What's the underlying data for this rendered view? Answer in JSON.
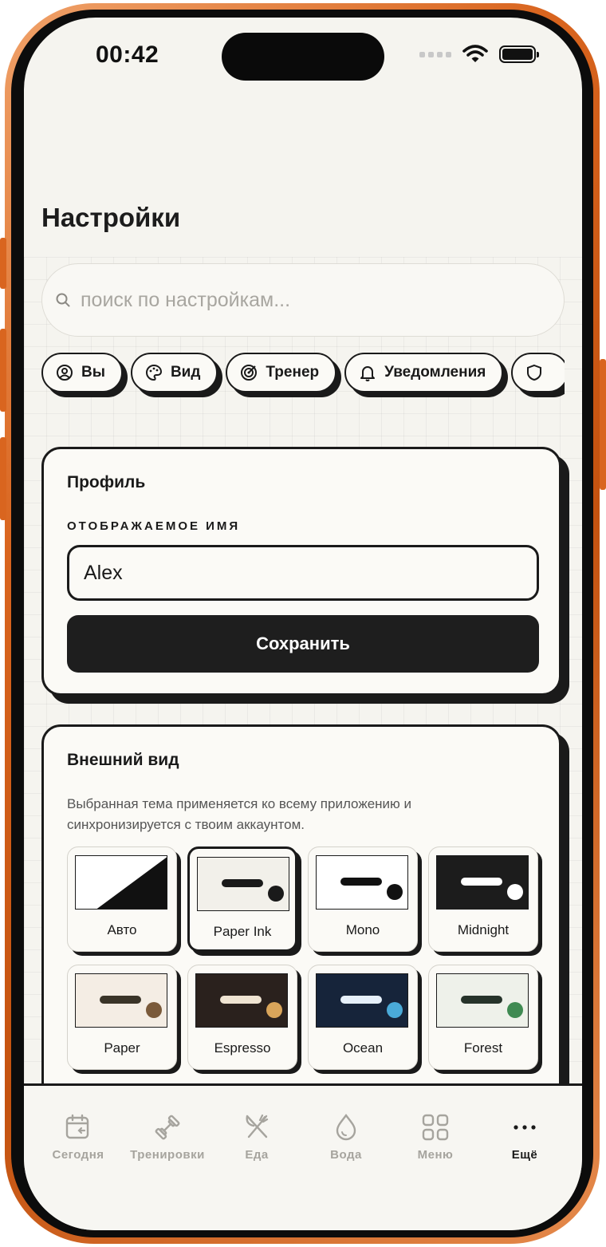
{
  "status_bar": {
    "time": "00:42"
  },
  "header": {
    "title": "Настройки"
  },
  "search": {
    "placeholder": "поиск по настройкам..."
  },
  "chips": [
    {
      "label": "Вы",
      "icon": "user-icon"
    },
    {
      "label": "Вид",
      "icon": "palette-icon"
    },
    {
      "label": "Тренер",
      "icon": "target-icon"
    },
    {
      "label": "Уведомления",
      "icon": "bell-icon"
    },
    {
      "label": "",
      "icon": "shield-icon"
    }
  ],
  "profile": {
    "title": "Профиль",
    "field_label": "ОТОБРАЖАЕМОЕ ИМЯ",
    "name_value": "Alex",
    "save_label": "Сохранить"
  },
  "appearance": {
    "title": "Внешний вид",
    "description": "Выбранная тема применяется ко всему приложению и синхронизируется с твоим аккаунтом.",
    "selected_theme": "Paper Ink",
    "themes": [
      {
        "name": "Авто",
        "bg": "#ffffff",
        "bar": "#111111",
        "dot": "#111111"
      },
      {
        "name": "Paper Ink",
        "bg": "#f2f0ea",
        "bar": "#1a1a1a",
        "dot": "#1a1a1a"
      },
      {
        "name": "Mono",
        "bg": "#ffffff",
        "bar": "#111111",
        "dot": "#111111"
      },
      {
        "name": "Midnight",
        "bg": "#1c1c1c",
        "bar": "#ffffff",
        "dot": "#ffffff"
      },
      {
        "name": "Paper",
        "bg": "#f4ede4",
        "bar": "#3a3428",
        "dot": "#7a5a3a"
      },
      {
        "name": "Espresso",
        "bg": "#2a211d",
        "bar": "#efe4d2",
        "dot": "#d9a55a"
      },
      {
        "name": "Ocean",
        "bg": "#16243a",
        "bar": "#e6f0fa",
        "dot": "#4aaad8"
      },
      {
        "name": "Forest",
        "bg": "#eef1ea",
        "bar": "#26332a",
        "dot": "#3f8a52"
      }
    ]
  },
  "tab_bar": {
    "active": "Ещё",
    "items": [
      {
        "label": "Сегодня",
        "icon": "calendar-icon"
      },
      {
        "label": "Тренировки",
        "icon": "dumbbell-icon"
      },
      {
        "label": "Еда",
        "icon": "utensils-icon"
      },
      {
        "label": "Вода",
        "icon": "water-drop-icon"
      },
      {
        "label": "Меню",
        "icon": "grid-icon"
      },
      {
        "label": "Ещё",
        "icon": "more-icon"
      }
    ]
  },
  "colors": {
    "background": "#f5f4ef",
    "ink": "#1a1a1a",
    "frame": "#d9651f",
    "muted": "#a6a49e"
  }
}
